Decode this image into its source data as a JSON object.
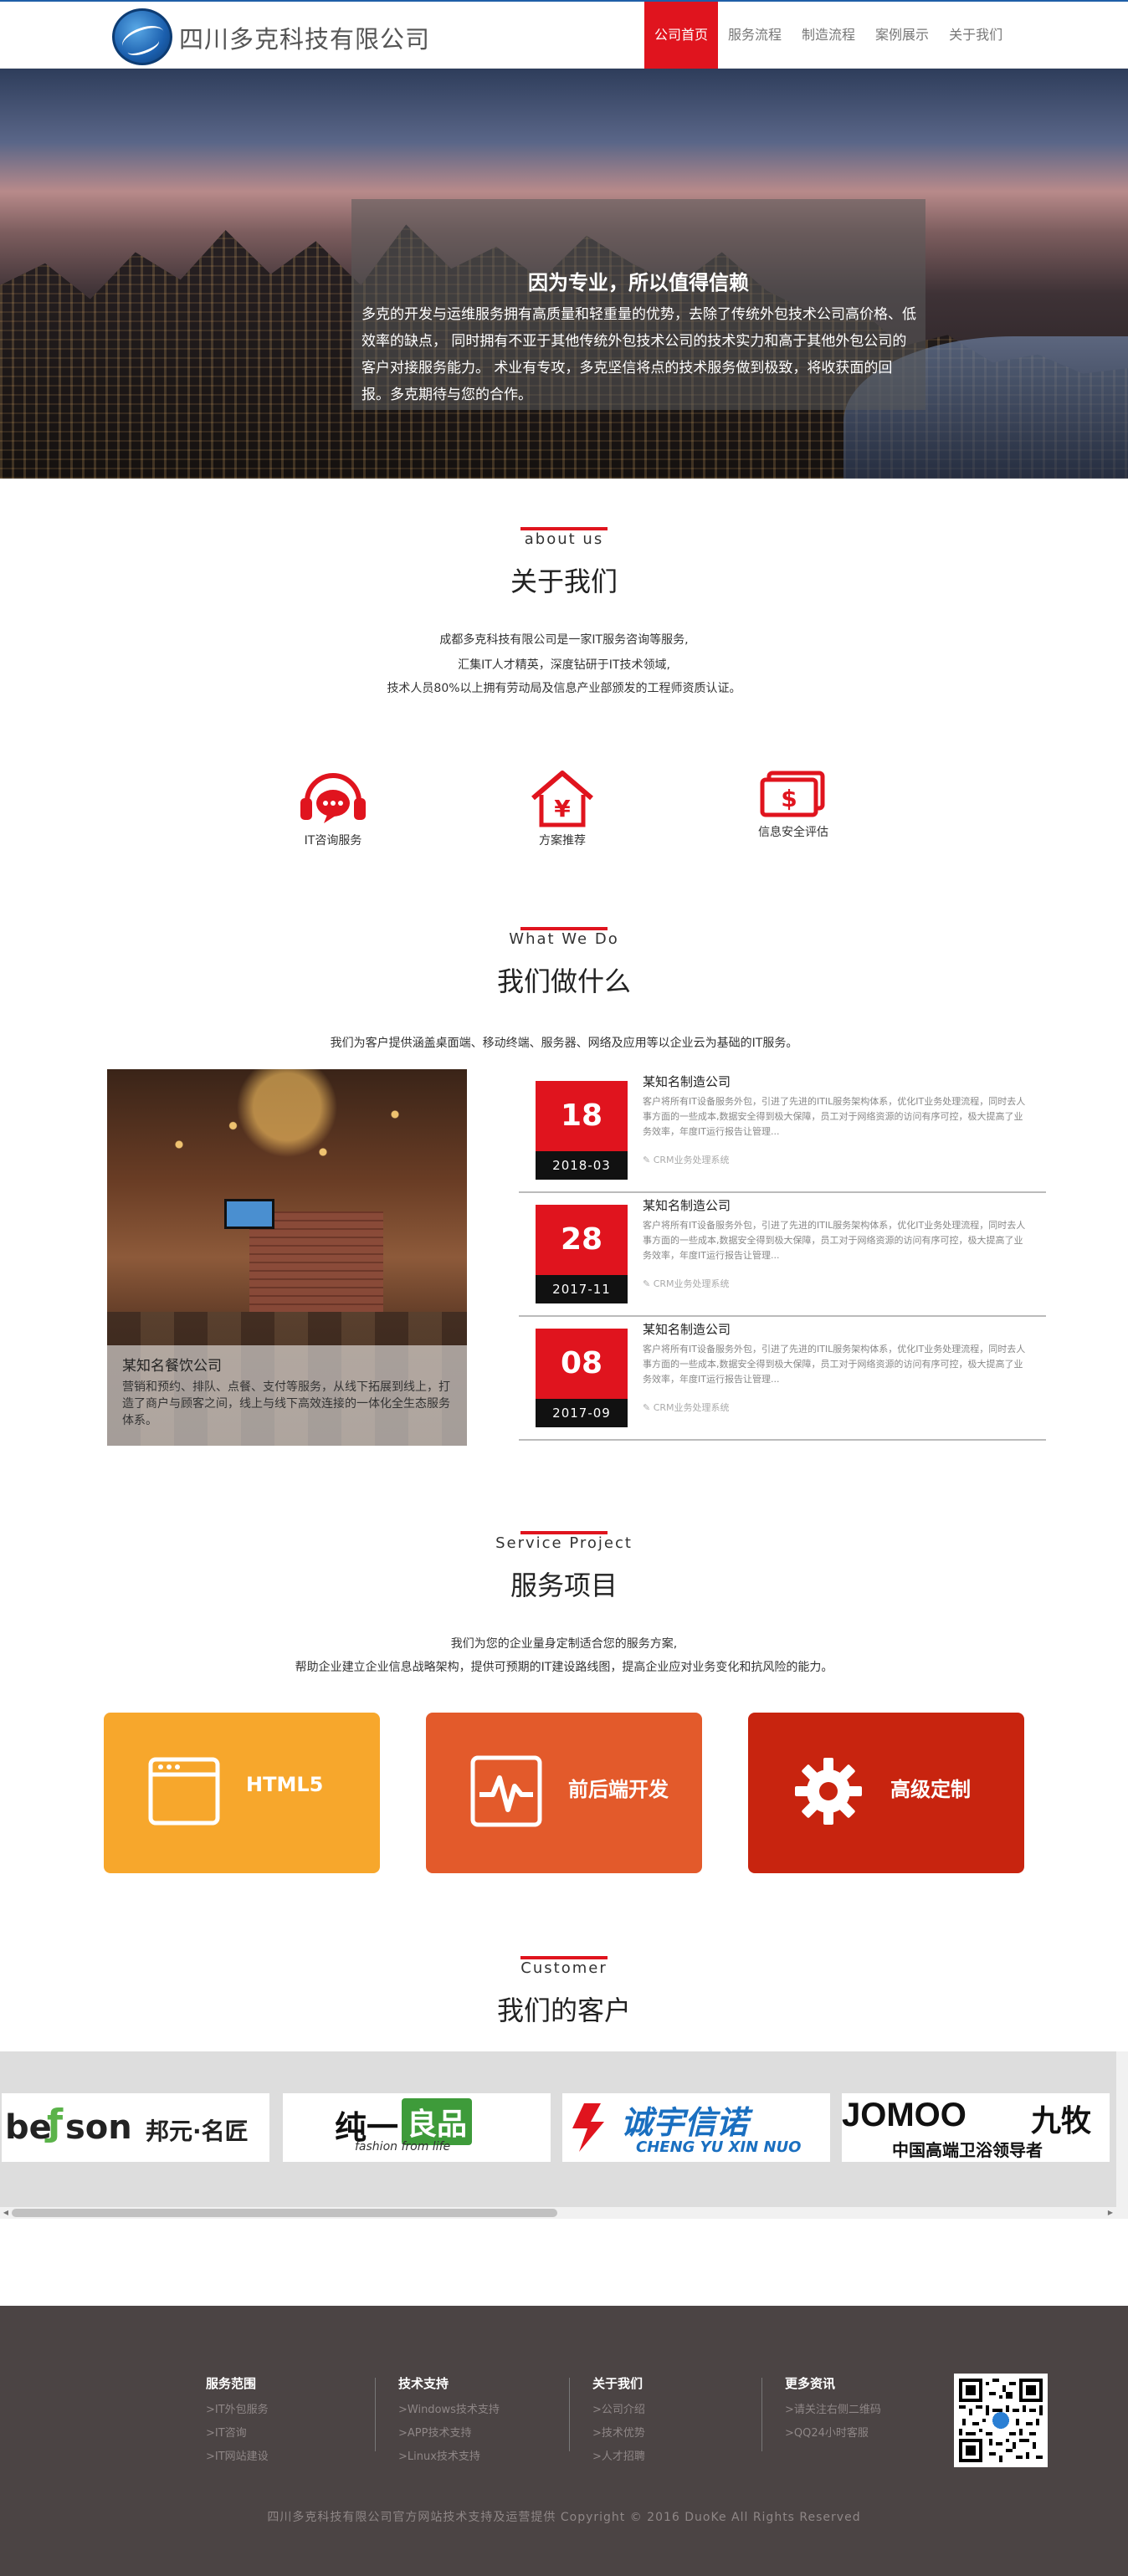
{
  "header": {
    "company_name": "四川多克科技有限公司",
    "nav": [
      "公司首页",
      "服务流程",
      "制造流程",
      "案例展示",
      "关于我们"
    ],
    "active_nav": "公司首页"
  },
  "hero": {
    "title": "因为专业，所以值得信赖",
    "text": "多克的开发与运维服务拥有高质量和轻重量的优势，去除了传统外包技术公司高价格、低效率的缺点， 同时拥有不亚于其他传统外包技术公司的技术实力和高于其他外包公司的客户对接服务能力。 术业有专攻，多克坚信将点的技术服务做到极致，将收获面的回报。多克期待与您的合作。"
  },
  "about": {
    "en": "about us",
    "cn": "关于我们",
    "desc": [
      "成都多克科技有限公司是一家IT服务咨询等服务,",
      "汇集IT人才精英，深度钻研于IT技术领域,",
      "技术人员80%以上拥有劳动局及信息产业部颁发的工程师资质认证。"
    ],
    "items": [
      {
        "label": "IT咨询服务",
        "icon": "headset-chat-icon"
      },
      {
        "label": "方案推荐",
        "icon": "home-yen-icon"
      },
      {
        "label": "信息安全评估",
        "icon": "cash-dollar-icon"
      }
    ]
  },
  "whatwedo": {
    "en": "What We Do",
    "cn": "我们做什么",
    "desc": "我们为客户提供涵盖桌面端、移动终端、服务器、网络及应用等以企业云为基础的IT服务。",
    "feature": {
      "title": "某知名餐饮公司",
      "text": "营销和预约、排队、点餐、支付等服务，从线下拓展到线上，打造了商户与顾客之间，线上与线下高效连接的一体化全生态服务体系。"
    },
    "news": [
      {
        "day": "18",
        "ym": "2018-03",
        "title": "某知名制造公司",
        "text": "客户将所有IT设备服务外包，引进了先进的ITIL服务架构体系，优化IT业务处理流程，同时去人事方面的一些成本,数据安全得到极大保障，员工对于网络资源的访问有序可控，极大提高了业务效率，年度IT运行报告让管理...",
        "tag": "CRM业务处理系统"
      },
      {
        "day": "28",
        "ym": "2017-11",
        "title": "某知名制造公司",
        "text": "客户将所有IT设备服务外包，引进了先进的ITIL服务架构体系，优化IT业务处理流程，同时去人事方面的一些成本,数据安全得到极大保障，员工对于网络资源的访问有序可控，极大提高了业务效率，年度IT运行报告让管理...",
        "tag": "CRM业务处理系统"
      },
      {
        "day": "08",
        "ym": "2017-09",
        "title": "某知名制造公司",
        "text": "客户将所有IT设备服务外包，引进了先进的ITIL服务架构体系，优化IT业务处理流程，同时去人事方面的一些成本,数据安全得到极大保障，员工对于网络资源的访问有序可控，极大提高了业务效率，年度IT运行报告让管理...",
        "tag": "CRM业务处理系统"
      }
    ]
  },
  "service": {
    "en": "Service Project",
    "cn": "服务项目",
    "desc": [
      "我们为您的企业量身定制适合您的服务方案,",
      "帮助企业建立企业信息战略架构，提供可预期的IT建设路线图，提高企业应对业务变化和抗风险的能力。"
    ],
    "cards": [
      {
        "label": "HTML5",
        "color": "#f7a72c",
        "icon": "browser-window-icon"
      },
      {
        "label": "前后端开发",
        "color": "#e35a2b",
        "icon": "pulse-monitor-icon"
      },
      {
        "label": "高级定制",
        "color": "#c8240f",
        "icon": "gear-icon"
      }
    ]
  },
  "customer": {
    "en": "Customer",
    "cn": "我们的客户",
    "logos": [
      {
        "main": "be",
        "mid": "son",
        "extra": "邦元·名匠"
      },
      {
        "main": "纯一",
        "mid": "良品",
        "extra": "fashion from life"
      },
      {
        "main": "诚宇信诺",
        "mid": "CHENG YU XIN NUO",
        "extra": ""
      },
      {
        "main": "JOMOO",
        "mid": "九牧",
        "extra": "中国高端卫浴领导者"
      }
    ]
  },
  "footer": {
    "columns": [
      {
        "title": "服务范围",
        "links": [
          ">IT外包服务",
          ">IT咨询",
          ">IT网站建设"
        ]
      },
      {
        "title": "技术支持",
        "links": [
          ">Windows技术支持",
          ">APP技术支持",
          ">Linux技术支持"
        ]
      },
      {
        "title": "关于我们",
        "links": [
          ">公司介绍",
          ">技术优势",
          ">人才招聘"
        ]
      },
      {
        "title": "更多资讯",
        "links": [
          ">请关注右侧二维码",
          ">QQ24小时客服"
        ]
      }
    ],
    "copyright": "四川多克科技有限公司官方网站技术支持及运营提供 Copyright © 2016 DuoKe All Rights Reserved"
  }
}
